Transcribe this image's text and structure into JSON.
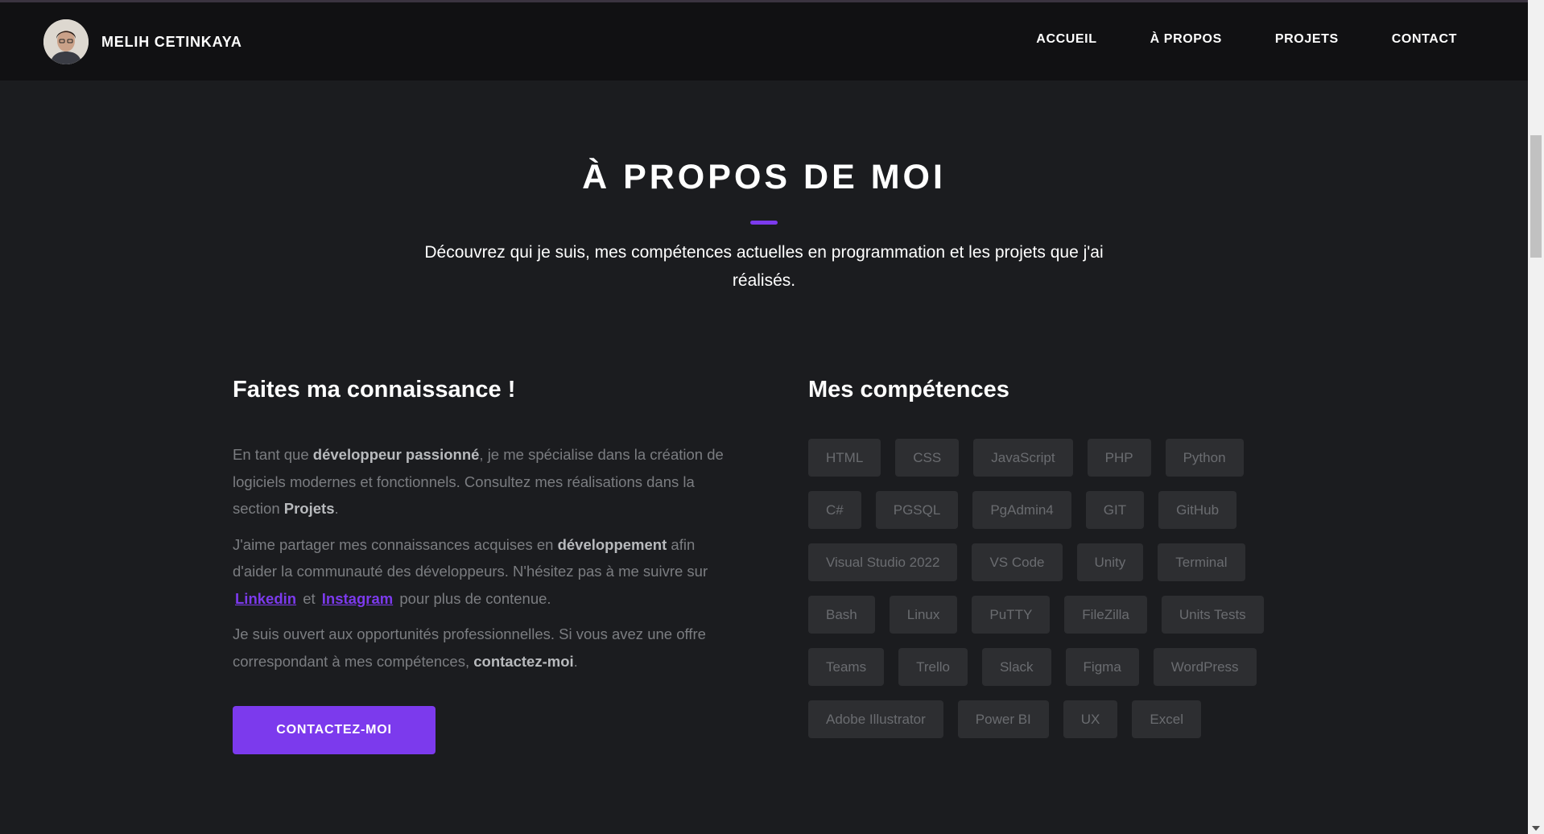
{
  "header": {
    "brand_name": "MELIH CETINKAYA",
    "nav": [
      {
        "label": "ACCUEIL"
      },
      {
        "label": "À PROPOS"
      },
      {
        "label": "PROJETS"
      },
      {
        "label": "CONTACT"
      }
    ]
  },
  "hero": {
    "title": "À PROPOS DE MOI",
    "subtitle": "Découvrez qui je suis, mes compétences actuelles en programmation et les projets que j'ai réalisés."
  },
  "about": {
    "heading": "Faites ma connaissance !",
    "p1": {
      "t1": "En tant que ",
      "b1": "développeur passionné",
      "t2": ", je me spécialise dans la création de logiciels modernes et fonctionnels. Consultez mes réalisations dans la section ",
      "b2": "Projets",
      "t3": "."
    },
    "p2": {
      "t1": "J'aime partager mes connaissances acquises en ",
      "b1": "développement",
      "t2": " afin d'aider la communauté des développeurs. N'hésitez pas à me suivre sur ",
      "link1": "Linkedin",
      "t3": " et ",
      "link2": "Instagram",
      "t4": " pour plus de contenue."
    },
    "p3": {
      "t1": "Je suis ouvert aux opportunités professionnelles. Si vous avez une offre correspondant à mes compétences, ",
      "b1": "contactez-moi",
      "t2": "."
    },
    "cta_label": "CONTACTEZ-MOI"
  },
  "skills": {
    "heading": "Mes compétences",
    "items": [
      "HTML",
      "CSS",
      "JavaScript",
      "PHP",
      "Python",
      "C#",
      "PGSQL",
      "PgAdmin4",
      "GIT",
      "GitHub",
      "Visual Studio 2022",
      "VS Code",
      "Unity",
      "Terminal",
      "Bash",
      "Linux",
      "PuTTY",
      "FileZilla",
      "Units Tests",
      "Teams",
      "Trello",
      "Slack",
      "Figma",
      "WordPress",
      "Adobe Illustrator",
      "Power BI",
      "UX",
      "Excel"
    ]
  },
  "colors": {
    "accent": "#7c3aed",
    "background": "#1b1c1f",
    "navbar": "#111113",
    "skill_chip": "#2d2e31"
  },
  "icons": {
    "avatar": "profile-photo"
  }
}
